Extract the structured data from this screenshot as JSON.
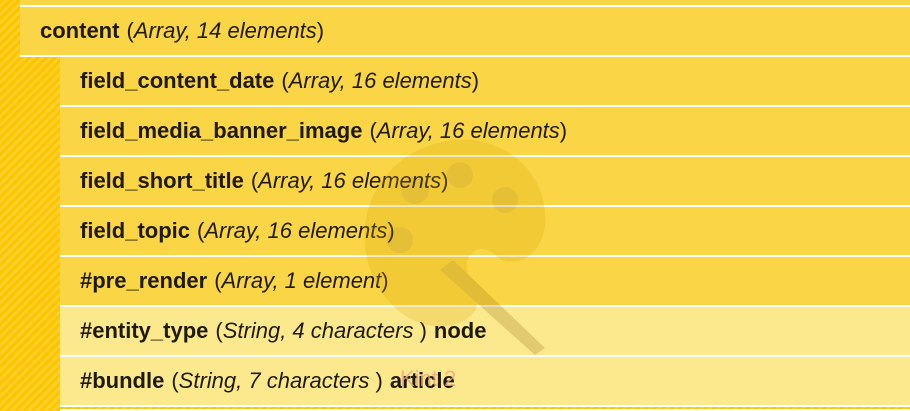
{
  "parent": {
    "key": "content",
    "open_paren": "(",
    "type": "Array, 14 elements",
    "close_paren": ")"
  },
  "children": [
    {
      "key": "field_content_date",
      "open_paren": "(",
      "type": "Array, 16 elements",
      "close_paren": ")"
    },
    {
      "key": "field_media_banner_image",
      "open_paren": "(",
      "type": "Array, 16 elements",
      "close_paren": ")"
    },
    {
      "key": "field_short_title",
      "open_paren": "(",
      "type": "Array, 16 elements",
      "close_paren": ")"
    },
    {
      "key": "field_topic",
      "open_paren": "(",
      "type": "Array, 16 elements",
      "close_paren": ")"
    },
    {
      "key": "#pre_render",
      "open_paren": "(",
      "type": "Array, 1 element",
      "close_paren": ")"
    },
    {
      "key": "#entity_type",
      "open_paren": "(",
      "type": "String, 4 characters ",
      "close_paren": ")",
      "value": "node"
    },
    {
      "key": "#bundle",
      "open_paren": "(",
      "type": "String, 7 characters ",
      "close_paren": ")",
      "value": "article"
    }
  ],
  "watermark": {
    "icon": "kint-palette-logo-icon",
    "text": "Kint 2"
  },
  "colors": {
    "stripe_a": "#ffc400",
    "stripe_b": "#ffd02a",
    "row_bg": "#fad546",
    "value_row_bg": "#fce98e",
    "divider": "#ffffff",
    "text": "#1f1a06"
  }
}
